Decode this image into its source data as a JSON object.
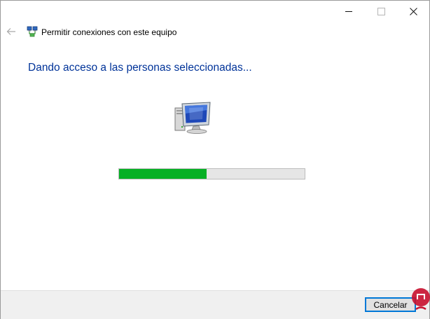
{
  "window": {
    "title": "Permitir conexiones con este equipo",
    "controls": [
      "minimize-icon",
      "maximize-icon",
      "close-icon"
    ]
  },
  "main": {
    "heading": "Dando acceso a las personas seleccionadas...",
    "icon": "network-computer-icon",
    "progress": 0.47
  },
  "footer": {
    "cancel_label": "Cancelar"
  },
  "colors": {
    "heading": "#003399",
    "progress_fill": "#06b025",
    "progress_track": "#e6e6e6",
    "button_border": "#0078d7"
  }
}
